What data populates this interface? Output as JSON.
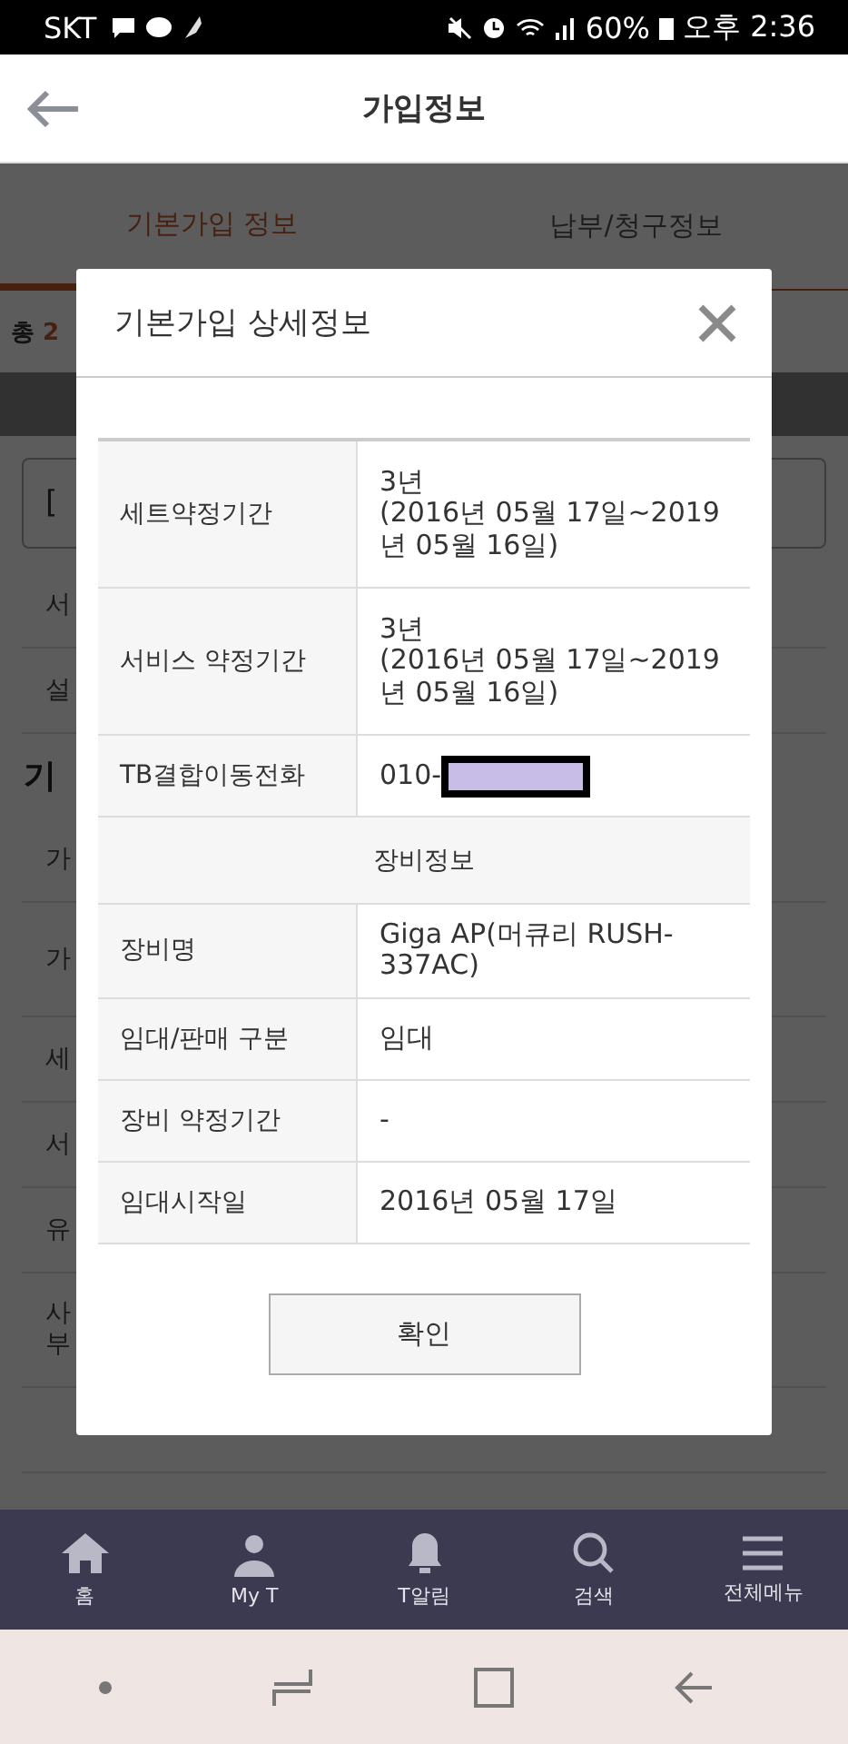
{
  "status_bar": {
    "carrier": "SKT",
    "battery": "60%",
    "time": "오후 2:36"
  },
  "header": {
    "title": "가입정보"
  },
  "tabs": [
    {
      "label": "기본가입 정보",
      "selected": true
    },
    {
      "label": "납부/청구정보",
      "selected": false
    }
  ],
  "count": {
    "prefix": "총 ",
    "number": "2"
  },
  "select": {
    "value": "["
  },
  "rows_top": [
    {
      "lines": [
        "서"
      ]
    },
    {
      "lines": [
        "설"
      ]
    }
  ],
  "section_title": "기",
  "rows": [
    {
      "lines": [
        "가"
      ],
      "tall": false
    },
    {
      "lines": [
        "가"
      ],
      "tall": true
    },
    {
      "lines": [
        "세"
      ],
      "tall": false
    },
    {
      "lines": [
        "서"
      ],
      "tall": false
    },
    {
      "lines": [
        "유"
      ],
      "tall": false
    },
    {
      "lines": [
        "사",
        "부"
      ],
      "tall": true
    }
  ],
  "modal": {
    "title": "기본가입 상세정보",
    "rows": [
      {
        "kind": "row",
        "label": "세트약정기간",
        "value": "3년\n(2016년 05월 17일~2019년 05월 16일)"
      },
      {
        "kind": "row",
        "label": "서비스 약정기간",
        "value": "3년\n(2016년 05월 17일~2019년 05월 16일)"
      },
      {
        "kind": "row",
        "label": "TB결합이동전화",
        "value": "010-",
        "redacted": true
      },
      {
        "kind": "section",
        "label": "장비정보"
      },
      {
        "kind": "row",
        "label": "장비명",
        "value": "Giga AP(머큐리 RUSH-337AC)"
      },
      {
        "kind": "row",
        "label": "임대/판매 구분",
        "value": "임대"
      },
      {
        "kind": "row",
        "label": "장비 약정기간",
        "value": "-"
      },
      {
        "kind": "row",
        "label": "임대시작일",
        "value": "2016년 05월 17일"
      }
    ],
    "button": "확인"
  },
  "nav": [
    {
      "label": "홈"
    },
    {
      "label": "My T"
    },
    {
      "label": "T알림"
    },
    {
      "label": "검색"
    },
    {
      "label": "전체메뉴"
    }
  ]
}
